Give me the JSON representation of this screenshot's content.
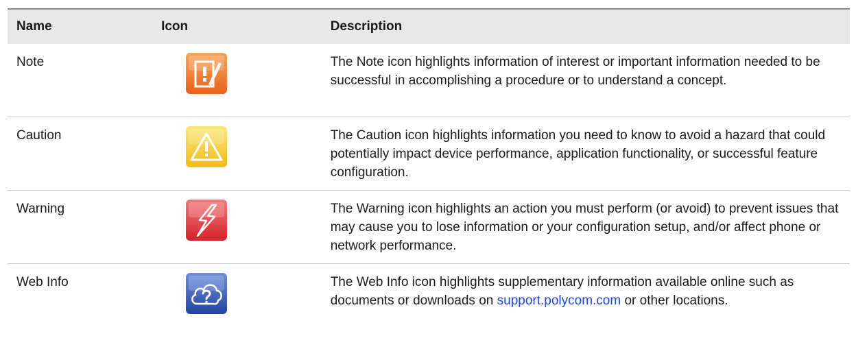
{
  "table": {
    "headers": {
      "name": "Name",
      "icon": "Icon",
      "description": "Description"
    },
    "rows": [
      {
        "name": "Note",
        "icon": "note-icon",
        "description": "The Note icon highlights information of interest or important information needed to be successful in accomplishing a procedure or to understand a concept."
      },
      {
        "name": "Caution",
        "icon": "caution-icon",
        "description": "The Caution icon highlights information you need to know to avoid a hazard that could potentially impact device performance, application functionality, or successful feature configuration."
      },
      {
        "name": "Warning",
        "icon": "warning-icon",
        "description": "The Warning icon highlights an action you must perform (or avoid) to prevent issues that may cause you to lose information or your configuration setup, and/or affect phone or network performance."
      },
      {
        "name": "Web Info",
        "icon": "web-info-icon",
        "description_before": "The Web Info icon highlights supplementary information available online such as documents or downloads on ",
        "description_link": "support.polycom.com",
        "description_after": " or other locations."
      }
    ]
  },
  "colors": {
    "header_background": "#e8e8e8",
    "link": "#1f47d6",
    "note_icon": "#f07a2a",
    "caution_icon": "#f4cc2c",
    "warning_icon": "#e2363c",
    "web_info_icon": "#2f56b8"
  }
}
